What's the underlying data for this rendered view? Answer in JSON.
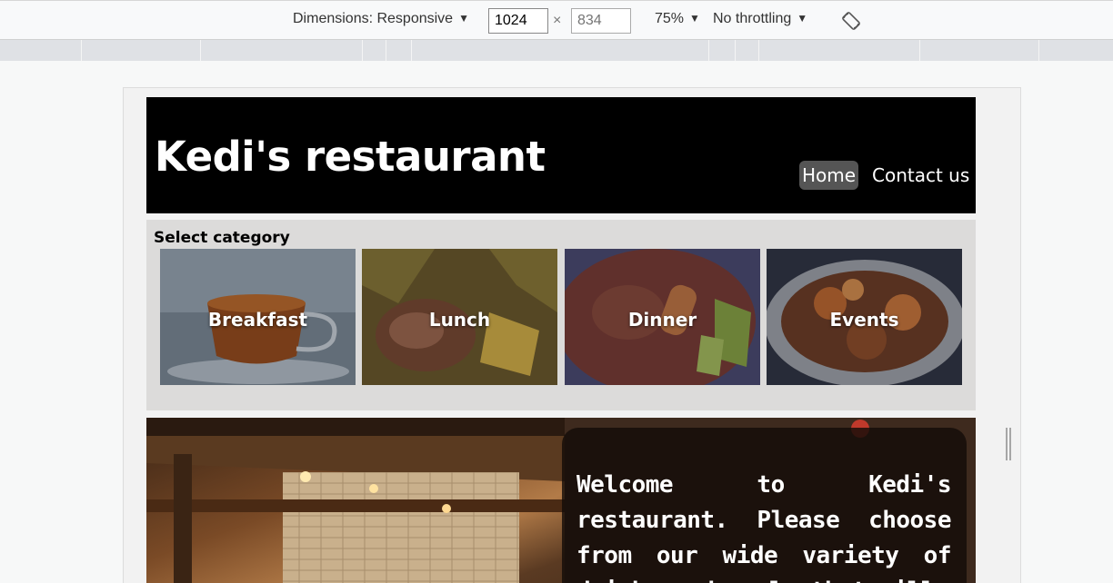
{
  "devtools": {
    "dimensions_label": "Dimensions: Responsive",
    "width_value": "1024",
    "height_placeholder": "834",
    "times": "×",
    "zoom": "75%",
    "throttling": "No throttling",
    "caret": "▼"
  },
  "site": {
    "title": "Kedi's restaurant",
    "nav": [
      "Home",
      "Contact us"
    ]
  },
  "category": {
    "title": "Select category",
    "items": [
      "Breakfast",
      "Lunch",
      "Dinner",
      "Events"
    ]
  },
  "hero": {
    "welcome": "Welcome to Kedi's restaurant. Please choose from our wide variety of drinks and meals that will"
  }
}
